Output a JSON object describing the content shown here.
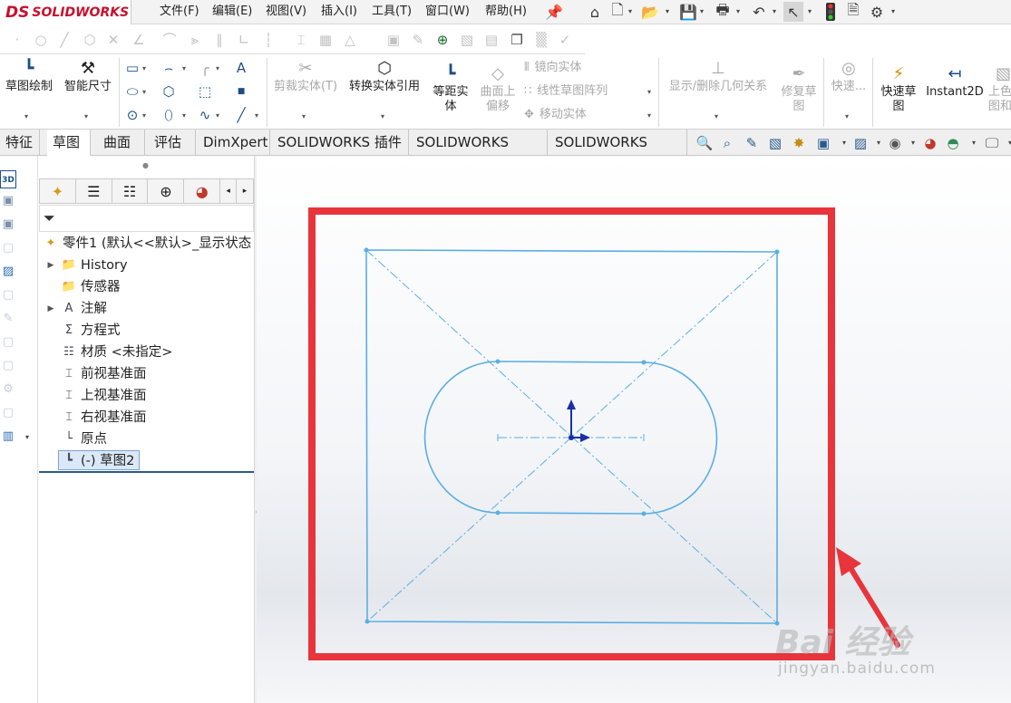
{
  "app": {
    "brand": "SOLIDWORKS",
    "brand_prefix": "DS"
  },
  "menu": [
    "文件(F)",
    "编辑(E)",
    "视图(V)",
    "插入(I)",
    "工具(T)",
    "窗口(W)",
    "帮助(H)"
  ],
  "quick_access_icons": [
    "home-icon",
    "new-document-icon",
    "open-icon",
    "save-icon",
    "print-icon",
    "undo-icon",
    "select-pointer-icon",
    "rebuild-icon",
    "file-properties-icon",
    "options-icon"
  ],
  "command_manager": {
    "sketch": "草图绘制",
    "smart_dimension": "智能尺寸",
    "trim": "剪裁实体(T)",
    "convert": "转换实体引用",
    "offset_line1": "等距实",
    "offset_line2": "体",
    "surface_offset_line1": "曲面上",
    "surface_offset_line2": "偏移",
    "mirror": "镜向实体",
    "linear_pattern": "线性草图阵列",
    "move": "移动实体",
    "relations": "显示/删除几何关系",
    "repair_line1": "修复草",
    "repair_line2": "图",
    "quick_snap": "快速...",
    "rapid_sketch_line1": "快速草",
    "rapid_sketch_line2": "图",
    "instant2d": "Instant2D",
    "shaded_line1": "上色",
    "shaded_line2": "图和"
  },
  "tabs": [
    "特征",
    "草图",
    "曲面",
    "评估",
    "DimXpert",
    "SOLIDWORKS 插件",
    "SOLIDWORKS MBD",
    "SOLIDWORKS CAM"
  ],
  "active_tab": "草图",
  "feature_tree": {
    "root": "零件1 (默认<<默认>_显示状态",
    "items": [
      {
        "label": "History",
        "expandable": true,
        "icon": "history-folder-icon"
      },
      {
        "label": "传感器",
        "expandable": false,
        "icon": "sensor-folder-icon"
      },
      {
        "label": "注解",
        "expandable": true,
        "icon": "annotation-icon"
      },
      {
        "label": "方程式",
        "expandable": false,
        "icon": "equation-icon"
      },
      {
        "label": "材质 <未指定>",
        "expandable": false,
        "icon": "material-icon"
      },
      {
        "label": "前视基准面",
        "expandable": false,
        "icon": "plane-icon"
      },
      {
        "label": "上视基准面",
        "expandable": false,
        "icon": "plane-icon"
      },
      {
        "label": "右视基准面",
        "expandable": false,
        "icon": "plane-icon"
      },
      {
        "label": "原点",
        "expandable": false,
        "icon": "origin-icon"
      },
      {
        "label": "(-) 草图2",
        "expandable": false,
        "icon": "sketch-icon",
        "selected": true
      }
    ]
  },
  "colors": {
    "sketch_line": "#5aaee3",
    "highlight_box": "#e8353b",
    "arrow": "#e8353b",
    "origin": "#1a2fa6"
  },
  "watermark": {
    "text": "Bai 经验",
    "url": "jingyan.baidu.com"
  }
}
